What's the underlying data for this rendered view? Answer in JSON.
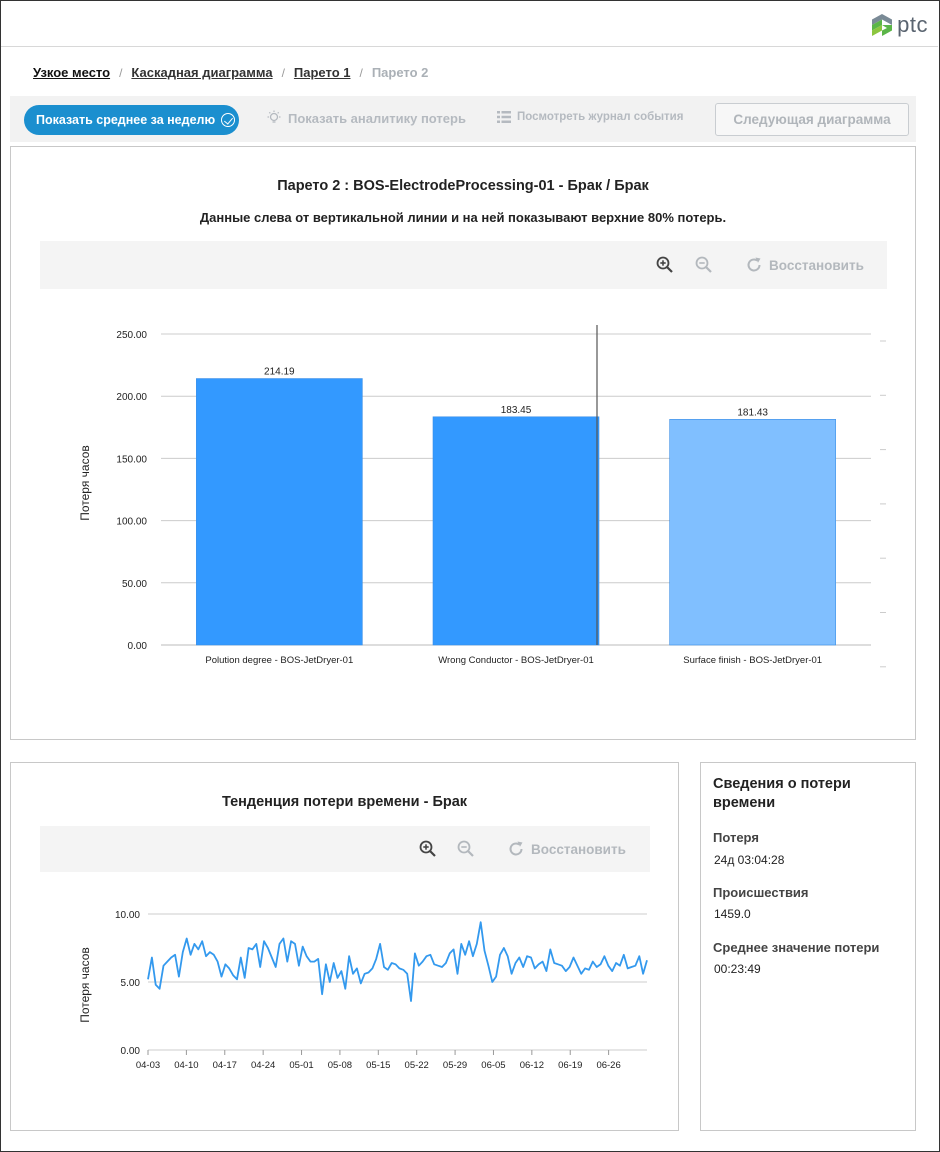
{
  "header": {
    "logo_text": "ptc",
    "logo_icon": "ptc-logo-icon",
    "brand_colors": [
      "#5bb548",
      "#7a8a96"
    ]
  },
  "breadcrumb": {
    "items": [
      {
        "label": "Узкое место"
      },
      {
        "label": "Каскадная диаграмма"
      },
      {
        "label": "Парето 1"
      }
    ],
    "current": "Парето 2",
    "separator": "/"
  },
  "toolbar": {
    "weekly_avg_label": "Показать среднее за неделю",
    "analytics_label": "Показать аналитику потерь",
    "journal_label": "Посмотреть журнал события",
    "next_chart_label": "Следующая диаграмма",
    "accent_color": "#1b8fcf"
  },
  "pareto": {
    "title": "Парето 2 : BOS-ElectrodeProcessing-01 - Брак / Брак",
    "subtitle": "Данные слева от вертикальной линии и на ней показывают верхние 80% потерь.",
    "restore_label": "Восстановить",
    "icons": [
      "zoom-in-icon",
      "zoom-out-icon",
      "refresh-icon"
    ]
  },
  "trend": {
    "title": "Тенденция потери времени - Брак",
    "restore_label": "Восстановить"
  },
  "info": {
    "title": "Сведения о потери времени",
    "loss_label": "Потеря",
    "loss_value": "24д 03:04:28",
    "incidents_label": "Происшествия",
    "incidents_value": "1459.0",
    "avg_label": "Среднее значение потери",
    "avg_value": "00:23:49"
  },
  "chart_data": [
    {
      "type": "bar",
      "categories": [
        "Polution degree - BOS-JetDryer-01",
        "Wrong Conductor - BOS-JetDryer-01",
        "Surface finish - BOS-JetDryer-01"
      ],
      "values": [
        214.19,
        183.45,
        181.43
      ],
      "value_labels": [
        "214.19",
        "183.45",
        "181.43"
      ],
      "ylabel": "Потеря часов",
      "ylim": [
        0,
        250
      ],
      "yticks": [
        "0.00",
        "50.00",
        "100.00",
        "150.00",
        "200.00",
        "250.00"
      ],
      "bar_colors": [
        "#3399ff",
        "#3399ff",
        "#80bfff"
      ],
      "cutoff_line_after_category": 1,
      "grid": true
    },
    {
      "type": "line",
      "ylabel": "Потеря часов",
      "ylim": [
        0,
        10
      ],
      "yticks": [
        "0.00",
        "5.00",
        "10.00"
      ],
      "xticks": [
        "04-03",
        "04-10",
        "04-17",
        "04-24",
        "05-01",
        "05-08",
        "05-15",
        "05-22",
        "05-29",
        "06-05",
        "06-12",
        "06-19",
        "06-26"
      ],
      "series_color": "#3399ee",
      "values": [
        5.2,
        6.8,
        4.8,
        4.5,
        6.2,
        6.5,
        6.8,
        7.0,
        5.4,
        7.2,
        8.2,
        7.0,
        7.8,
        7.4,
        8.0,
        6.9,
        7.2,
        7.0,
        6.5,
        5.4,
        6.3,
        6.0,
        5.5,
        5.2,
        6.8,
        5.3,
        7.5,
        7.4,
        7.8,
        6.1,
        8.0,
        7.5,
        6.8,
        6.1,
        7.8,
        8.2,
        6.5,
        8.0,
        7.8,
        6.2,
        7.6,
        6.9,
        6.5,
        6.5,
        6.7,
        4.1,
        6.3,
        5.0,
        6.4,
        5.3,
        5.8,
        4.5,
        6.9,
        5.6,
        6.0,
        4.9,
        5.6,
        5.7,
        6.0,
        6.7,
        7.8,
        6.1,
        5.9,
        6.4,
        6.3,
        6.0,
        5.9,
        5.6,
        3.6,
        7.1,
        6.2,
        6.5,
        6.9,
        7.0,
        6.3,
        6.2,
        6.1,
        6.4,
        7.1,
        7.4,
        5.6,
        7.8,
        7.0,
        8.0,
        6.9,
        7.8,
        9.4,
        7.3,
        6.2,
        5.0,
        5.4,
        7.0,
        7.5,
        6.9,
        5.6,
        6.4,
        6.8,
        6.1,
        6.9,
        6.8,
        6.0,
        6.3,
        6.5,
        5.8,
        7.4,
        6.4,
        6.3,
        6.2,
        5.8,
        6.1,
        6.8,
        6.2,
        5.6,
        6.0,
        5.9,
        6.5,
        6.1,
        6.3,
        6.9,
        6.2,
        5.8,
        6.4,
        6.2,
        7.0,
        6.0,
        6.1,
        6.2,
        6.9,
        5.6,
        6.6
      ]
    }
  ]
}
